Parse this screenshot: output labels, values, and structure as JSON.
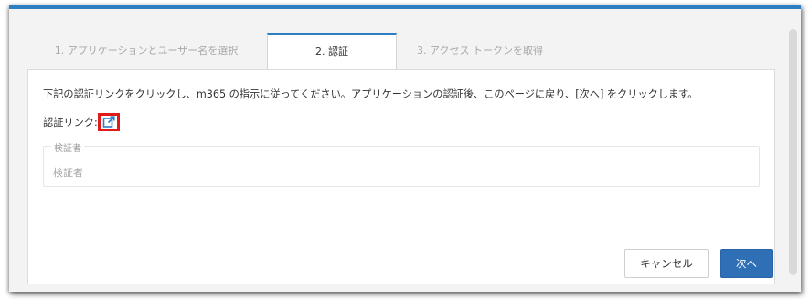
{
  "wizard": {
    "tabs": [
      {
        "label": "1. アプリケーションとユーザー名を選択",
        "state": "inactive"
      },
      {
        "label": "2. 認証",
        "state": "active"
      },
      {
        "label": "3. アクセス トークンを取得",
        "state": "inactive"
      }
    ]
  },
  "auth": {
    "instruction": "下記の認証リンクをクリックし、m365 の指示に従ってください。アプリケーションの認証後、このページに戻り、[次へ] をクリックします。",
    "link_label": "認証リンク:",
    "link_icon": "external-link-icon"
  },
  "verifier": {
    "label": "検証者",
    "placeholder": "検証者",
    "value": ""
  },
  "actions": {
    "cancel_label": "キャンセル",
    "next_label": "次へ"
  },
  "colors": {
    "accent": "#2d7fc4",
    "primary_button": "#2e6fb5",
    "highlight": "#e01b1b"
  }
}
